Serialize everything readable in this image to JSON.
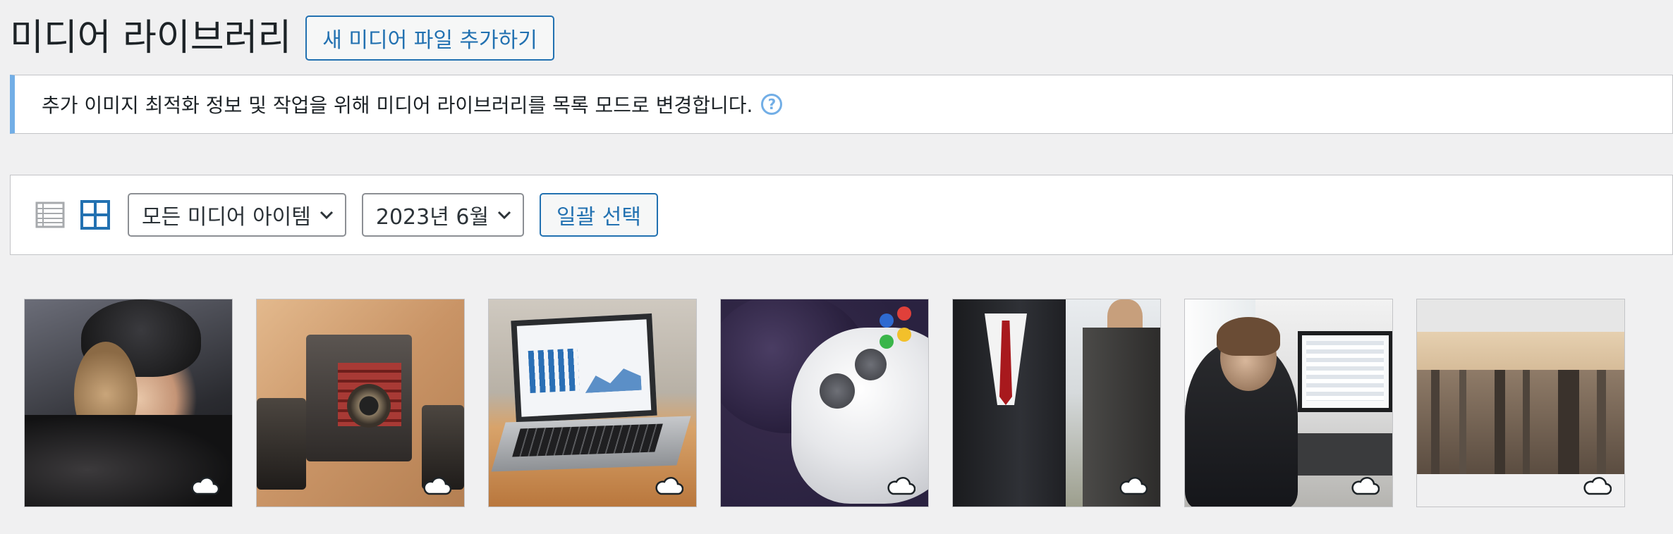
{
  "page": {
    "title": "미디어 라이브러리",
    "add_new_label": "새 미디어 파일 추가하기"
  },
  "notice": {
    "text": "추가 이미지 최적화 정보 및 작업을 위해 미디어 라이브러리를 목록 모드로 변경합니다."
  },
  "toolbar": {
    "view_modes": [
      "list-view-icon",
      "grid-view-icon"
    ],
    "active_view": "grid",
    "media_type_filter": "모든 미디어 아이템",
    "date_filter": "2023년 6월",
    "bulk_select_label": "일괄 선택"
  },
  "grid": {
    "items": [
      {
        "subject": "woman in fur hat",
        "icon": "cloud-icon"
      },
      {
        "subject": "vintage cameras",
        "icon": "cloud-icon"
      },
      {
        "subject": "laptop with charts",
        "icon": "cloud-icon"
      },
      {
        "subject": "game controller",
        "icon": "cloud-icon"
      },
      {
        "subject": "business people",
        "icon": "cloud-icon"
      },
      {
        "subject": "man at computer",
        "icon": "cloud-icon"
      },
      {
        "subject": "city skyline",
        "icon": "cloud-icon"
      }
    ]
  },
  "colors": {
    "accent": "#2271b1",
    "notice_border": "#72aee6",
    "background": "#f0f0f1"
  }
}
